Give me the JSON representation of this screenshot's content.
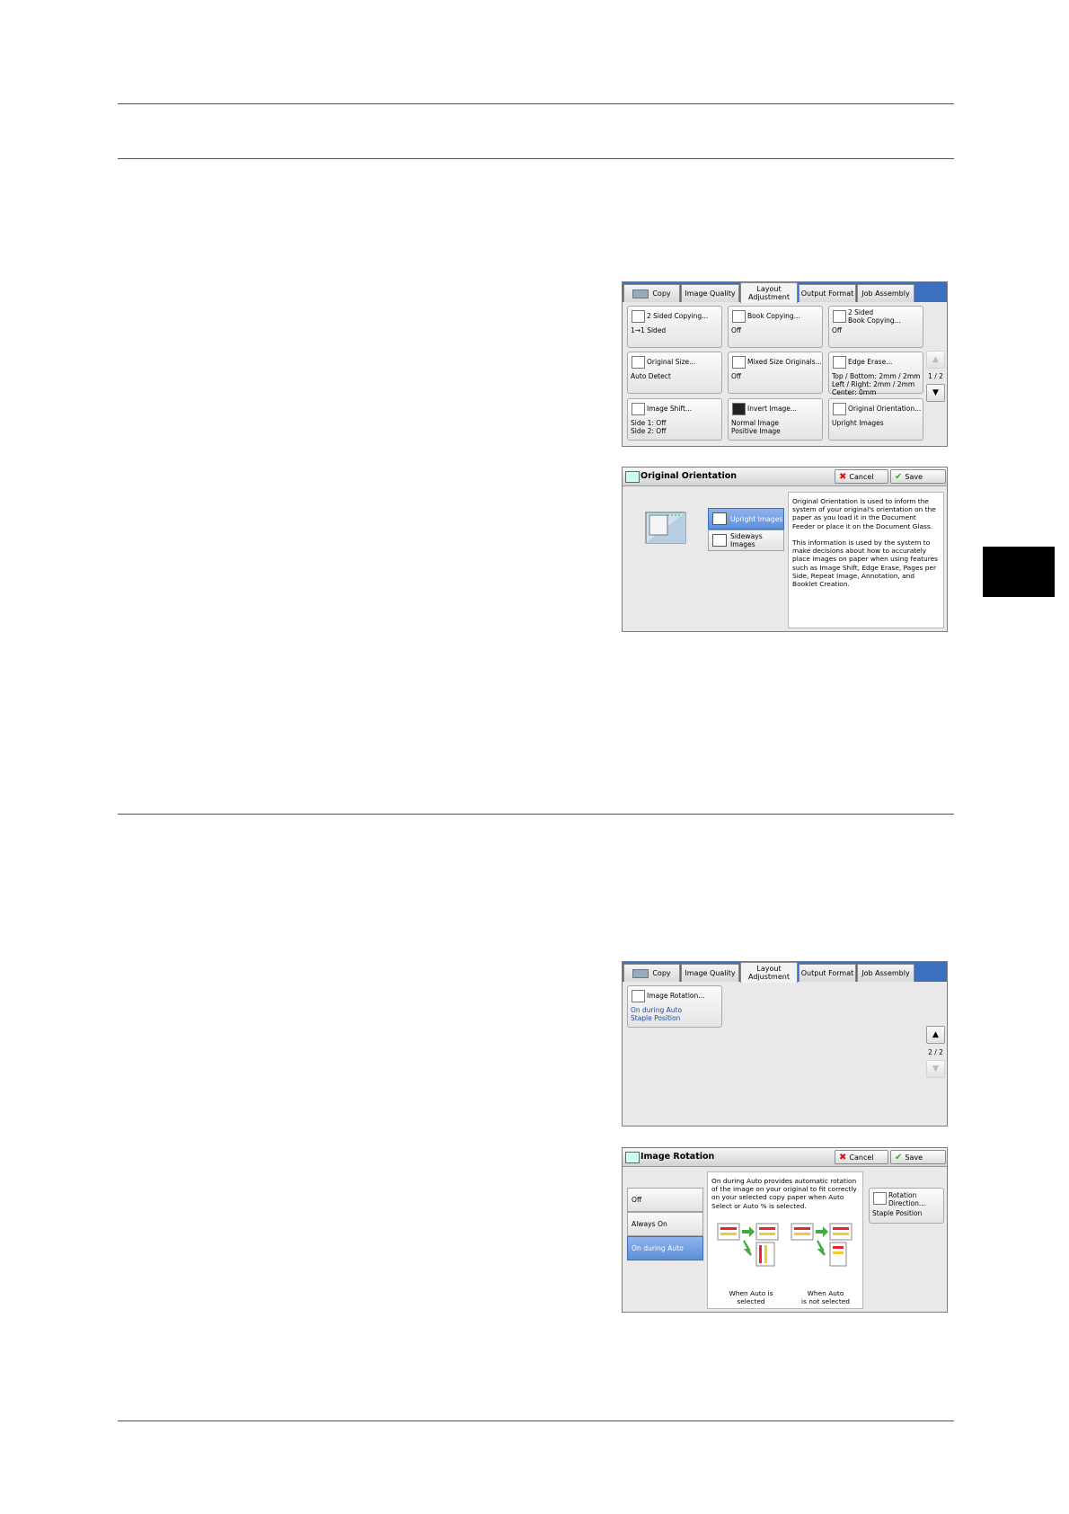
{
  "tabs": [
    "Copy",
    "Image Quality",
    "Layout Adjustment",
    "Output Format",
    "Job Assembly"
  ],
  "screen1": {
    "buttons": [
      {
        "title": "2 Sided Copying...",
        "value": "1→1 Sided"
      },
      {
        "title": "Book Copying...",
        "value": "Off"
      },
      {
        "title": "2 Sided\nBook Copying...",
        "value": "Off"
      },
      {
        "title": "Original Size...",
        "value": "Auto Detect"
      },
      {
        "title": "Mixed Size Originals...",
        "value": "Off"
      },
      {
        "title": "Edge Erase...",
        "value": "Top / Bottom: 2mm / 2mm\nLeft / Right: 2mm / 2mm\nCenter: 0mm"
      },
      {
        "title": "Image Shift...",
        "value": "Side 1: Off\nSide 2: Off"
      },
      {
        "title": "Invert Image...",
        "value": "Normal Image\nPositive Image"
      },
      {
        "title": "Original Orientation...",
        "value": "Upright Images"
      }
    ],
    "page": "1 / 2",
    "up": "▲",
    "down": "▼"
  },
  "screen2": {
    "title": "Original Orientation",
    "cancel": "Cancel",
    "save": "Save",
    "options": [
      "Upright Images",
      "Sideways Images"
    ],
    "description": "Original Orientation is used to inform the system of your original's orientation on the paper as you load it in the Document Feeder or place it on the Document Glass.\n\nThis information is used by the system to make decisions about how to accurately place images on paper when using features such as Image Shift, Edge Erase, Pages per Side, Repeat Image, Annotation, and Booklet Creation."
  },
  "screen3": {
    "button_title": "Image Rotation...",
    "button_value": "On during Auto\nStaple Position",
    "page": "2 / 2",
    "up": "▲",
    "down": "▼"
  },
  "screen4": {
    "title": "Image Rotation",
    "cancel": "Cancel",
    "save": "Save",
    "options": [
      "Off",
      "Always On",
      "On during Auto"
    ],
    "description": "On during Auto provides automatic rotation of the image on your original to fit correctly on your selected copy paper when Auto Select or Auto % is selected.",
    "caption_left": "When Auto is selected",
    "caption_right": "When Auto\nis not selected",
    "rotation_title": "Rotation\nDirection...",
    "rotation_value": "Staple Position"
  }
}
